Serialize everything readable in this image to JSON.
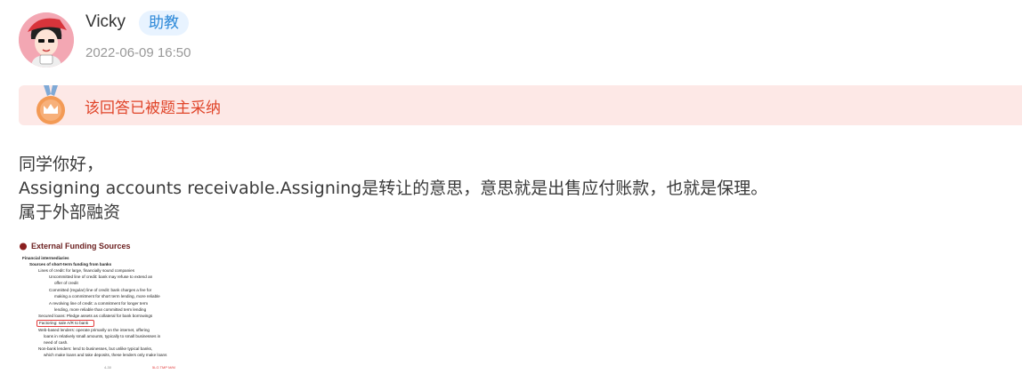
{
  "author": {
    "name": "Vicky",
    "role_badge": "助教",
    "time": "2022-06-09 16:50"
  },
  "accepted_banner": {
    "text": "该回答已被题主采纳",
    "icon": "medal-icon"
  },
  "answer": {
    "lines": [
      "同学你好，",
      "Assigning accounts receivable.Assigning是转让的意思，意思就是出售应付账款，也就是保理。",
      "属于外部融资"
    ]
  },
  "attachment": {
    "title": "External Funding Sources",
    "lines": [
      "Financial intermediaries",
      "Sources of short-term funding from banks",
      "Lines of credit: for large, financially sound companies",
      "Uncommitted line of credit: bank may refuse to extend an",
      "offer of credit",
      "Committed (regular) line of credit: bank charges a fee for",
      "making a commitment for short term lending, more reliable",
      "A revolving line of credit: a commitment for longer term",
      "lending, more reliable than committed term lending",
      "Secured loans: Pledge assets as collateral for bank borrowings",
      "Factoring: sale A/R to bank",
      "Web-based lenders: operate primarily on the internet, offering",
      "loans in relatively small amounts, typically to small businesses in",
      "need of cash.",
      "Non-bank lenders: lend to businesses, but unlike typical banks,",
      "which make loans and take deposits, these lenders only make loans"
    ],
    "footer_left": "4-30",
    "footer_right": "5LG  TMP  M/M"
  },
  "colors": {
    "accent_blue": "#2b88d8",
    "accepted_red": "#e0452a",
    "banner_bg": "#fde8e6"
  }
}
